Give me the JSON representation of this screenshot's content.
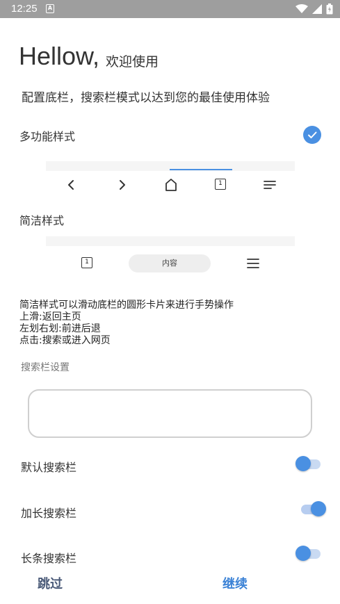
{
  "status_bar": {
    "time": "12:25",
    "notification": "A"
  },
  "header": {
    "hello": "Hellow,",
    "welcome": "欢迎使用",
    "subtitle": "配置底栏，搜索栏模式以达到您的最佳使用体验"
  },
  "styles": {
    "multi": {
      "label": "多功能样式",
      "selected": true,
      "tab_count": "1"
    },
    "simple": {
      "label": "简洁样式",
      "tab_count": "1",
      "pill_text": "内容"
    }
  },
  "description": [
    "简洁样式可以滑动底栏的圆形卡片来进行手势操作",
    "上滑:返回主页",
    "左划右划:前进后退",
    "点击:搜索或进入网页"
  ],
  "search_settings": {
    "section_label": "搜索栏设置",
    "options": [
      {
        "label": "默认搜索栏",
        "on": false
      },
      {
        "label": "加长搜索栏",
        "on": true
      },
      {
        "label": "长条搜索栏",
        "on": false
      }
    ]
  },
  "footer": {
    "skip": "跳过",
    "continue": "继续"
  },
  "colors": {
    "accent": "#4a90e2",
    "status_bar": "#9e9e9e",
    "switch_track_off": "#c9daf2",
    "switch_track_on": "#b7cdf0"
  }
}
